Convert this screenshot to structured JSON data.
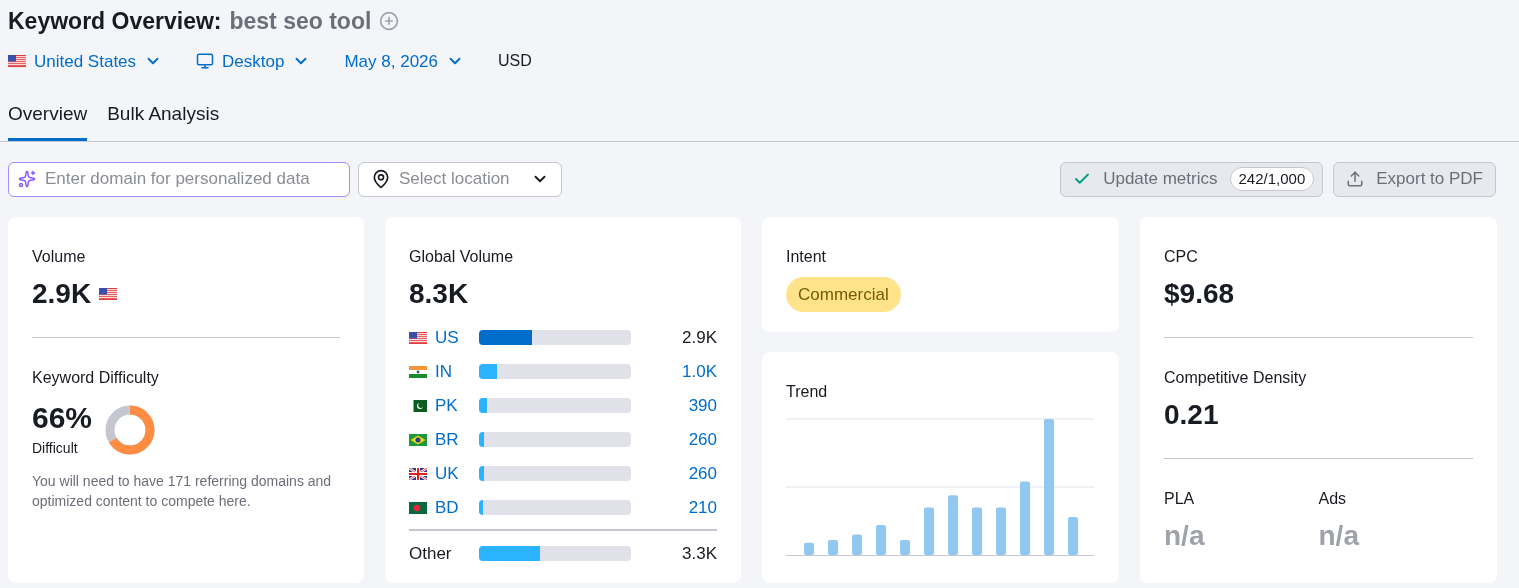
{
  "header": {
    "title": "Keyword Overview:",
    "keyword": "best seo tool"
  },
  "selectors": [
    {
      "kind": "country",
      "label": "United States"
    },
    {
      "kind": "device",
      "label": "Desktop"
    },
    {
      "kind": "date",
      "label": "May 8, 2026"
    }
  ],
  "currency": "USD",
  "tabs": [
    {
      "label": "Overview",
      "selected": true
    },
    {
      "label": "Bulk Analysis",
      "selected": false
    }
  ],
  "domain_field": {
    "placeholder": "Enter domain for personalized data"
  },
  "location_select": {
    "placeholder": "Select location"
  },
  "update_button": {
    "label": "Update metrics",
    "count": "242/1,000"
  },
  "export_button": {
    "label": "Export to PDF"
  },
  "volume": {
    "label": "Volume",
    "value": "2.9K"
  },
  "keyword_difficulty": {
    "label": "Keyword Difficulty",
    "value": "66%",
    "rating": "Difficult",
    "note": "You will need to have 171 referring domains and optimized content to compete here."
  },
  "global_volume": {
    "label": "Global Volume",
    "value": "8.3K",
    "countries": [
      {
        "code": "US",
        "value": "2.9K",
        "level": 0.35,
        "selected": true
      },
      {
        "code": "IN",
        "value": "1.0K",
        "level": 0.12,
        "selected": false
      },
      {
        "code": "PK",
        "value": "390",
        "level": 0.05,
        "selected": false
      },
      {
        "code": "BR",
        "value": "260",
        "level": 0.03,
        "selected": false
      },
      {
        "code": "UK",
        "value": "260",
        "level": 0.03,
        "selected": false
      },
      {
        "code": "BD",
        "value": "210",
        "level": 0.025,
        "selected": false
      }
    ],
    "other": {
      "label": "Other",
      "value": "3.3K",
      "level": 0.4
    }
  },
  "intent": {
    "label": "Intent",
    "badge": "Commercial"
  },
  "trend": {
    "label": "Trend"
  },
  "cpc": {
    "label": "CPC",
    "value": "$9.68"
  },
  "competitive_density": {
    "label": "Competitive Density",
    "value": "0.21"
  },
  "pla": {
    "label": "PLA",
    "value": "n/a"
  },
  "ads": {
    "label": "Ads",
    "value": "n/a"
  }
}
